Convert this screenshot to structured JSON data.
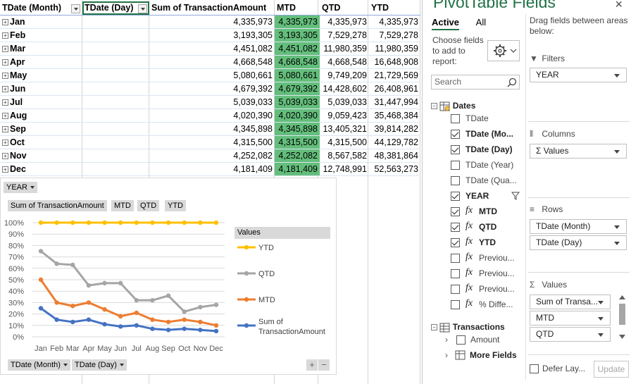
{
  "pivot": {
    "headers": [
      "TDate (Month)",
      "TDate (Day)",
      "Sum of TransactionAmount",
      "MTD",
      "QTD",
      "YTD"
    ],
    "rows": [
      {
        "month": "Jan",
        "sum": "4,335,973",
        "mtd": "4,335,973",
        "qtd": "4,335,973",
        "ytd": "4,335,973"
      },
      {
        "month": "Feb",
        "sum": "3,193,305",
        "mtd": "3,193,305",
        "qtd": "7,529,278",
        "ytd": "7,529,278"
      },
      {
        "month": "Mar",
        "sum": "4,451,082",
        "mtd": "4,451,082",
        "qtd": "11,980,359",
        "ytd": "11,980,359"
      },
      {
        "month": "Apr",
        "sum": "4,668,548",
        "mtd": "4,668,548",
        "qtd": "4,668,548",
        "ytd": "16,648,908"
      },
      {
        "month": "May",
        "sum": "5,080,661",
        "mtd": "5,080,661",
        "qtd": "9,749,209",
        "ytd": "21,729,569"
      },
      {
        "month": "Jun",
        "sum": "4,679,392",
        "mtd": "4,679,392",
        "qtd": "14,428,602",
        "ytd": "26,408,961"
      },
      {
        "month": "Jul",
        "sum": "5,039,033",
        "mtd": "5,039,033",
        "qtd": "5,039,033",
        "ytd": "31,447,994"
      },
      {
        "month": "Aug",
        "sum": "4,020,390",
        "mtd": "4,020,390",
        "qtd": "9,059,423",
        "ytd": "35,468,384"
      },
      {
        "month": "Sep",
        "sum": "4,345,898",
        "mtd": "4,345,898",
        "qtd": "13,405,321",
        "ytd": "39,814,282"
      },
      {
        "month": "Oct",
        "sum": "4,315,500",
        "mtd": "4,315,500",
        "qtd": "4,315,500",
        "ytd": "44,129,782"
      },
      {
        "month": "Nov",
        "sum": "4,252,082",
        "mtd": "4,252,082",
        "qtd": "8,567,582",
        "ytd": "48,381,864"
      },
      {
        "month": "Dec",
        "sum": "4,181,409",
        "mtd": "4,181,409",
        "qtd": "12,748,991",
        "ytd": "52,563,273"
      }
    ],
    "highlight_color": "#63be7b"
  },
  "chart": {
    "filter_button": "YEAR",
    "value_buttons": [
      "Sum of TransactionAmount",
      "MTD",
      "QTD",
      "YTD"
    ],
    "axis_buttons": [
      "TDate (Month)",
      "TDate (Day)"
    ],
    "legend_title": "Values",
    "legend": [
      "YTD",
      "QTD",
      "MTD",
      "Sum of TransactionAmount"
    ],
    "plus": "+",
    "minus": "−"
  },
  "chart_data": {
    "type": "line",
    "categories": [
      "Jan",
      "Feb",
      "Mar",
      "Apr",
      "May",
      "Jun",
      "Jul",
      "Aug",
      "Sep",
      "Oct",
      "Nov",
      "Dec"
    ],
    "y_ticks": [
      "100%",
      "90%",
      "80%",
      "70%",
      "60%",
      "50%",
      "40%",
      "30%",
      "20%",
      "10%",
      "0%"
    ],
    "ylim": [
      0,
      100
    ],
    "grid": true,
    "legend_position": "right",
    "series": [
      {
        "name": "YTD",
        "color": "#ffc000",
        "values": [
          100,
          100,
          100,
          100,
          100,
          100,
          100,
          100,
          100,
          100,
          100,
          100
        ]
      },
      {
        "name": "QTD",
        "color": "#a5a5a5",
        "values": [
          75,
          64,
          63,
          45,
          47,
          47,
          32,
          32,
          36,
          22,
          26,
          28
        ]
      },
      {
        "name": "MTD",
        "color": "#ed7d31",
        "values": [
          50,
          30,
          27,
          30,
          24,
          18,
          21,
          15,
          13,
          15,
          13,
          10
        ]
      },
      {
        "name": "Sum of TransactionAmount",
        "color": "#4472c4",
        "values": [
          25,
          15,
          13,
          15,
          11,
          9,
          10,
          7,
          6,
          7,
          6,
          5
        ]
      }
    ]
  },
  "panel": {
    "title": "PivotTable Fields",
    "close": "×",
    "tab_active": "Active",
    "tab_all": "All",
    "choose_text": "Choose fields to add to report:",
    "search_placeholder": "Search",
    "drag_text": "Drag fields between areas below:",
    "groups": {
      "dates": "Dates",
      "transactions": "Transactions",
      "more": "More Fields"
    },
    "fields": [
      {
        "label": "TDate",
        "checked": false,
        "fx": false
      },
      {
        "label": "TDate (Mo...",
        "checked": true,
        "fx": false
      },
      {
        "label": "TDate (Day)",
        "checked": true,
        "fx": false
      },
      {
        "label": "TDate (Year)",
        "checked": false,
        "fx": false
      },
      {
        "label": "TDate (Qua...",
        "checked": false,
        "fx": false
      },
      {
        "label": "YEAR",
        "checked": true,
        "fx": false
      },
      {
        "label": "MTD",
        "checked": true,
        "fx": true
      },
      {
        "label": "QTD",
        "checked": true,
        "fx": true
      },
      {
        "label": "YTD",
        "checked": true,
        "fx": true
      },
      {
        "label": "Previou...",
        "checked": false,
        "fx": true
      },
      {
        "label": "Previou...",
        "checked": false,
        "fx": true
      },
      {
        "label": "Previou...",
        "checked": false,
        "fx": true
      },
      {
        "label": "% Diffe...",
        "checked": false,
        "fx": true
      }
    ],
    "amount_label": "Amount",
    "areas": {
      "filters": "Filters",
      "columns": "Columns",
      "rows": "Rows",
      "values": "Values"
    },
    "filters_items": [
      "YEAR"
    ],
    "columns_items": [
      "Σ Values"
    ],
    "rows_items": [
      "TDate (Month)",
      "TDate (Day)"
    ],
    "values_items": [
      "Sum of Transa...",
      "MTD",
      "QTD"
    ],
    "defer_label": "Defer Lay...",
    "update_label": "Update"
  }
}
